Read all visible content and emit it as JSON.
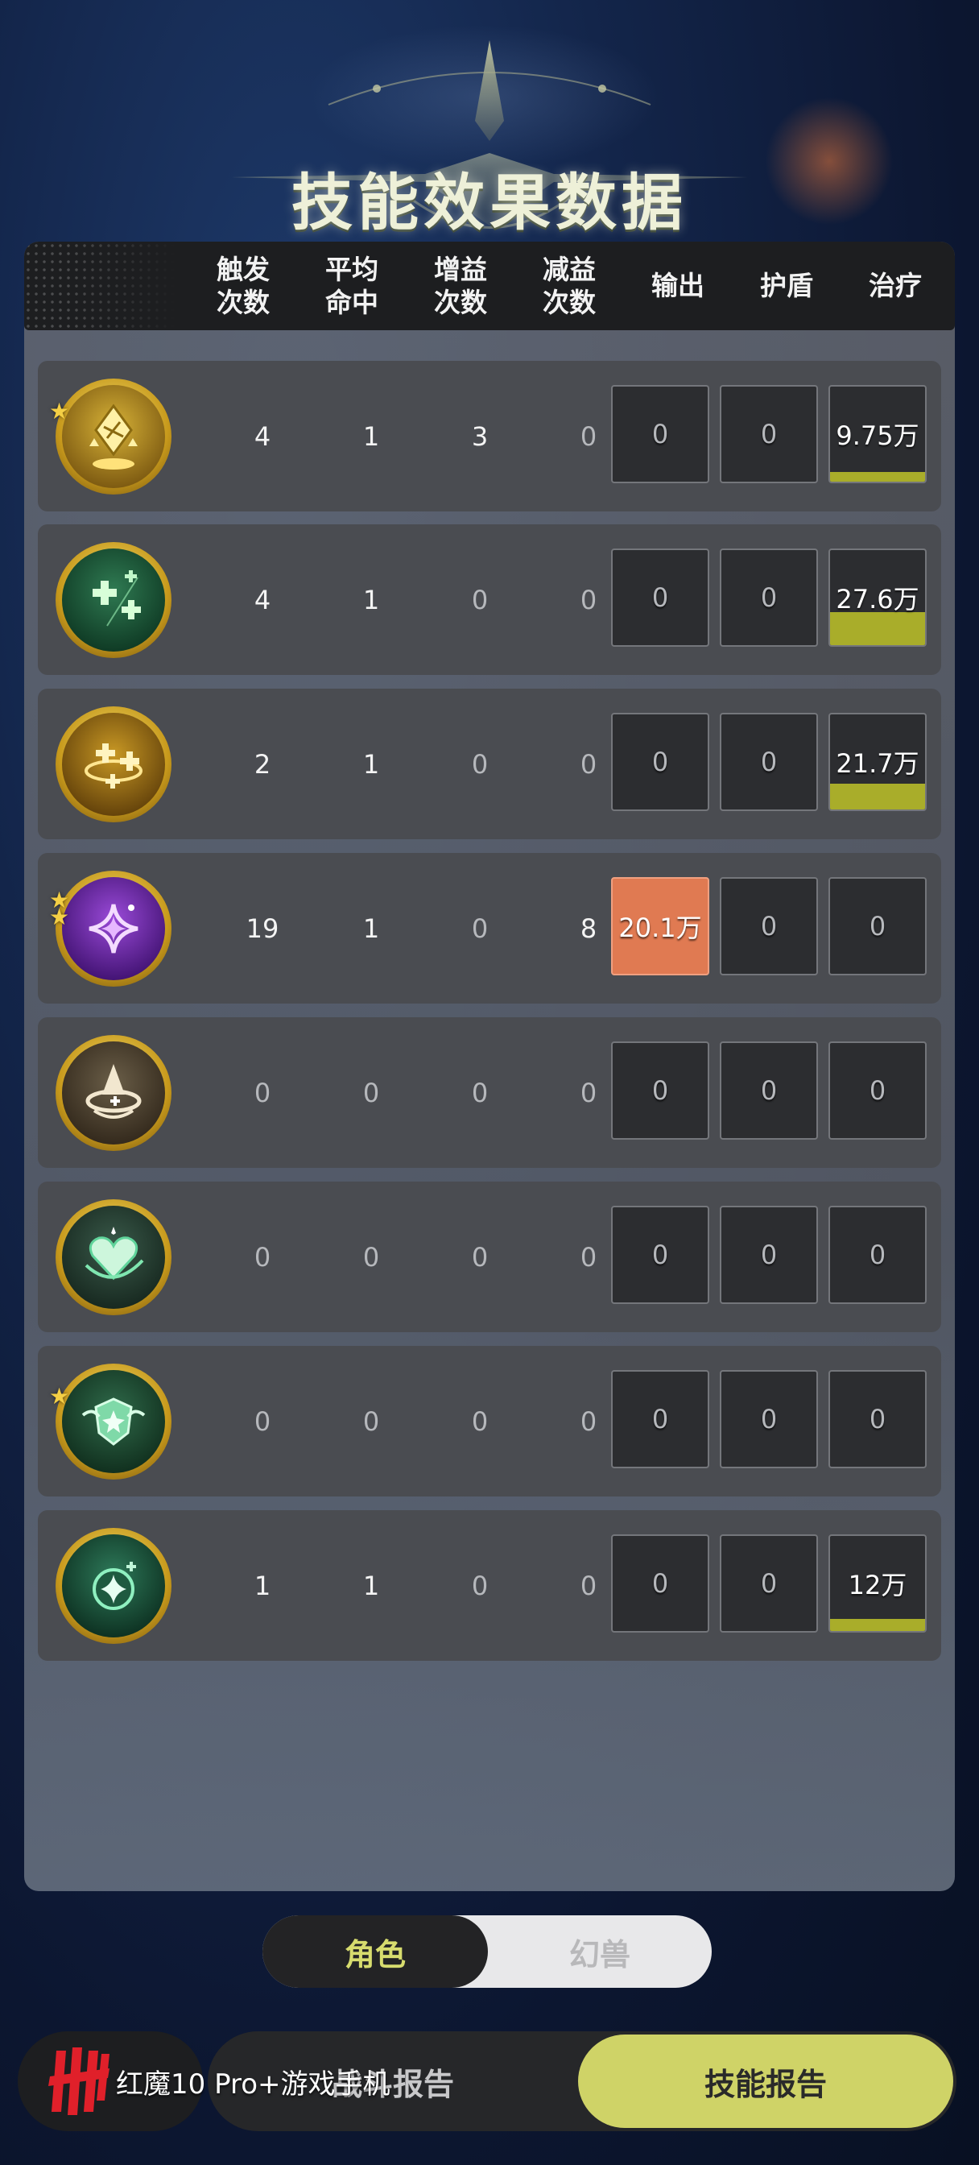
{
  "page": {
    "title": "技能效果数据"
  },
  "columns": [
    {
      "line1": "触发",
      "line2": "次数"
    },
    {
      "line1": "平均",
      "line2": "命中"
    },
    {
      "line1": "增益",
      "line2": "次数"
    },
    {
      "line1": "减益",
      "line2": "次数"
    },
    {
      "line1": "输出",
      "line2": ""
    },
    {
      "line1": "护盾",
      "line2": ""
    },
    {
      "line1": "治疗",
      "line2": ""
    }
  ],
  "rows": [
    {
      "icon": "golden-crystal-crown-icon",
      "stars": "★",
      "trigger": "4",
      "hit": "1",
      "buff": "3",
      "debuff": "0",
      "output": "0",
      "shield": "0",
      "heal": "9.75万",
      "heal_bar_fraction": 0.1
    },
    {
      "icon": "green-sparkle-cross-icon",
      "stars": "",
      "trigger": "4",
      "hit": "1",
      "buff": "0",
      "debuff": "0",
      "output": "0",
      "shield": "0",
      "heal": "27.6万",
      "heal_bar_fraction": 0.35
    },
    {
      "icon": "golden-cross-ring-icon",
      "stars": "",
      "trigger": "2",
      "hit": "1",
      "buff": "0",
      "debuff": "0",
      "output": "0",
      "shield": "0",
      "heal": "21.7万",
      "heal_bar_fraction": 0.27
    },
    {
      "icon": "purple-four-point-star-icon",
      "stars": "★★",
      "trigger": "19",
      "hit": "1",
      "buff": "0",
      "debuff": "8",
      "output": "20.1万",
      "shield": "0",
      "heal": "0",
      "output_highlight": true
    },
    {
      "icon": "ivory-spiral-hat-icon",
      "stars": "",
      "trigger": "0",
      "hit": "0",
      "buff": "0",
      "debuff": "0",
      "output": "0",
      "shield": "0",
      "heal": "0"
    },
    {
      "icon": "green-heart-icon",
      "stars": "",
      "trigger": "0",
      "hit": "0",
      "buff": "0",
      "debuff": "0",
      "output": "0",
      "shield": "0",
      "heal": "0"
    },
    {
      "icon": "green-winged-shield-icon",
      "stars": "★",
      "trigger": "0",
      "hit": "0",
      "buff": "0",
      "debuff": "0",
      "output": "0",
      "shield": "0",
      "heal": "0"
    },
    {
      "icon": "green-sparkle-orb-icon",
      "stars": "",
      "trigger": "1",
      "hit": "1",
      "buff": "0",
      "debuff": "0",
      "output": "0",
      "shield": "0",
      "heal": "12万",
      "heal_bar_fraction": 0.13
    }
  ],
  "toggle": {
    "active": "角色",
    "inactive": "幻兽"
  },
  "bottom_tabs": {
    "battle": "战斗报告",
    "skill": "技能报告"
  },
  "brand": {
    "text": "红魔10 Pro+游戏手机"
  },
  "colors": {
    "accent": "#cfd367",
    "heal_bar": "#a9ad2a",
    "output_highlight": "#e07a52"
  }
}
